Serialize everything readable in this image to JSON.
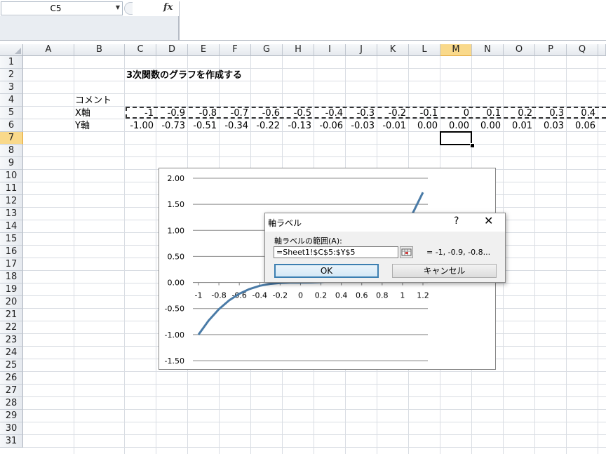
{
  "formula_bar": {
    "name_box": "C5",
    "fx_label": "fx",
    "formula": ""
  },
  "columns": [
    "A",
    "B",
    "C",
    "D",
    "E",
    "F",
    "G",
    "H",
    "I",
    "J",
    "K",
    "L",
    "M",
    "N",
    "O",
    "P",
    "Q"
  ],
  "rows": [
    "1",
    "2",
    "3",
    "4",
    "5",
    "6",
    "7",
    "8",
    "9",
    "10",
    "11",
    "12",
    "13",
    "14",
    "15",
    "16",
    "17",
    "18",
    "19",
    "20",
    "21",
    "22",
    "23",
    "24",
    "25",
    "26",
    "27",
    "28",
    "29",
    "30",
    "31"
  ],
  "selected": {
    "column": "M",
    "row": "7"
  },
  "sheet": {
    "title": "3次関数のグラフを作成する",
    "comment_label": "コメント",
    "x_label": "X軸",
    "y_label": "Y軸",
    "x_values": [
      "-1",
      "-0.9",
      "-0.8",
      "-0.7",
      "-0.6",
      "-0.5",
      "-0.4",
      "-0.3",
      "-0.2",
      "-0.1",
      "0",
      "0.1",
      "0.2",
      "0.3",
      "0.4"
    ],
    "y_values": [
      "-1.00",
      "-0.73",
      "-0.51",
      "-0.34",
      "-0.22",
      "-0.13",
      "-0.06",
      "-0.03",
      "-0.01",
      "0.00",
      "0.00",
      "0.00",
      "0.01",
      "0.03",
      "0.06"
    ]
  },
  "chart_data": {
    "type": "line",
    "title": "",
    "xlabel": "",
    "ylabel": "",
    "categories": [
      "-1",
      "-0.8",
      "-0.6",
      "-0.4",
      "-0.2",
      "0",
      "0.2",
      "0.4",
      "0.6",
      "0.8",
      "1",
      "1.2"
    ],
    "y_ticks": [
      "2.00",
      "1.50",
      "1.00",
      "0.50",
      "0.00",
      "-0.50",
      "-1.00",
      "-1.50"
    ],
    "ylim": [
      -1.5,
      2.0
    ],
    "grid": true,
    "series": [
      {
        "color": "#4a7ba7",
        "x": [
          -1,
          -0.9,
          -0.8,
          -0.7,
          -0.6,
          -0.5,
          -0.4,
          -0.3,
          -0.2,
          -0.1,
          0,
          0.1,
          0.2,
          0.3,
          0.4,
          0.5,
          0.6,
          0.7,
          0.8,
          0.9,
          1,
          1.1,
          1.2
        ],
        "values": [
          -1,
          -0.729,
          -0.512,
          -0.343,
          -0.216,
          -0.125,
          -0.064,
          -0.027,
          -0.008,
          -0.001,
          0,
          0.001,
          0.008,
          0.027,
          0.064,
          0.125,
          0.216,
          0.343,
          0.512,
          0.729,
          1,
          1.331,
          1.728
        ]
      }
    ]
  },
  "dialog": {
    "title": "軸ラベル",
    "help": "?",
    "close": "✕",
    "range_label": "軸ラベルの範囲(A):",
    "range_value": "=Sheet1!$C$5:$Y$5",
    "preview": "= -1, -0.9, -0.8...",
    "ok_label": "OK",
    "cancel_label": "キャンセル"
  }
}
